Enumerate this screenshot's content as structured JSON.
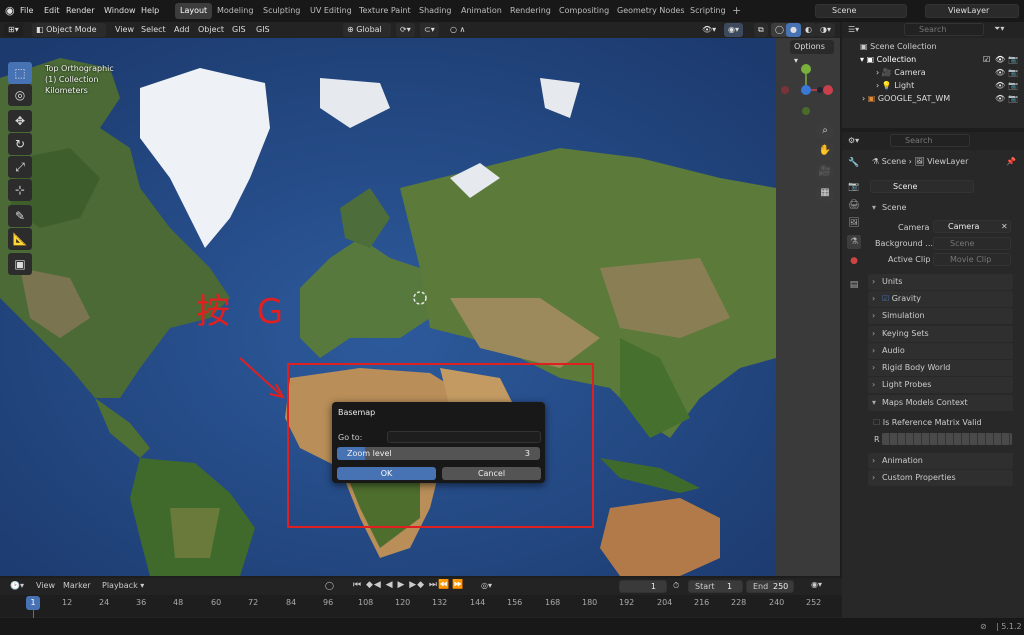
{
  "menu": {
    "file": "File",
    "edit": "Edit",
    "render": "Render",
    "window": "Window",
    "help": "Help"
  },
  "workspaces": [
    "Layout",
    "Modeling",
    "Sculpting",
    "UV Editing",
    "Texture Paint",
    "Shading",
    "Animation",
    "Rendering",
    "Compositing",
    "Geometry Nodes",
    "Scripting"
  ],
  "scene_name": "Scene",
  "view_layer": "ViewLayer",
  "vp_header": {
    "mode": "Object Mode",
    "view": "View",
    "select": "Select",
    "add": "Add",
    "object": "Object",
    "gis1": "GIS",
    "gis2": "GIS",
    "orientation": "Global",
    "options": "Options"
  },
  "overlay_text": {
    "line1": "Top Orthographic",
    "line2": "(1) Collection",
    "line3": "Kilometers"
  },
  "annotation": {
    "text": "按 G"
  },
  "dialog": {
    "title": "Basemap",
    "goto_label": "Go to:",
    "goto_value": "",
    "zoom_label": "Zoom level",
    "zoom_value": "3",
    "ok": "OK",
    "cancel": "Cancel"
  },
  "outliner": {
    "search_placeholder": "Search",
    "root": "Scene Collection",
    "collection": "Collection",
    "camera": "Camera",
    "light": "Light",
    "map": "GOOGLE_SAT_WM"
  },
  "properties": {
    "search_placeholder": "Search",
    "breadcrumb_scene": "Scene",
    "breadcrumb_layer": "ViewLayer",
    "datablock": "Scene",
    "scene_panel": "Scene",
    "camera_label": "Camera",
    "camera_value": "Camera",
    "background_label": "Background ...",
    "background_value": "Scene",
    "clip_label": "Active Clip",
    "clip_value": "Movie Clip",
    "panels": [
      "Units",
      "Gravity",
      "Simulation",
      "Keying Sets",
      "Audio",
      "Rigid Body World",
      "Light Probes"
    ],
    "maps_panel": "Maps Models Context",
    "is_ref": "Is Reference Matrix Valid",
    "r_label": "R",
    "panels_bottom": [
      "Animation",
      "Custom Properties"
    ]
  },
  "timeline": {
    "view": "View",
    "marker": "Marker",
    "playback": "Playback",
    "current_frame": "1",
    "start_label": "Start",
    "start": "1",
    "end_label": "End",
    "end": "250",
    "ticks": [
      "1",
      "12",
      "24",
      "36",
      "48",
      "60",
      "72",
      "84",
      "96",
      "108",
      "120",
      "132",
      "144",
      "156",
      "168",
      "180",
      "192",
      "204",
      "216",
      "228",
      "240",
      "252"
    ]
  },
  "status": {
    "version": "5.1.2"
  },
  "colors": {
    "accent": "#4772b3",
    "axis_x": "#c8414a",
    "axis_y": "#7ab03c",
    "axis_z": "#3a78d6",
    "annotation": "#e02020"
  }
}
